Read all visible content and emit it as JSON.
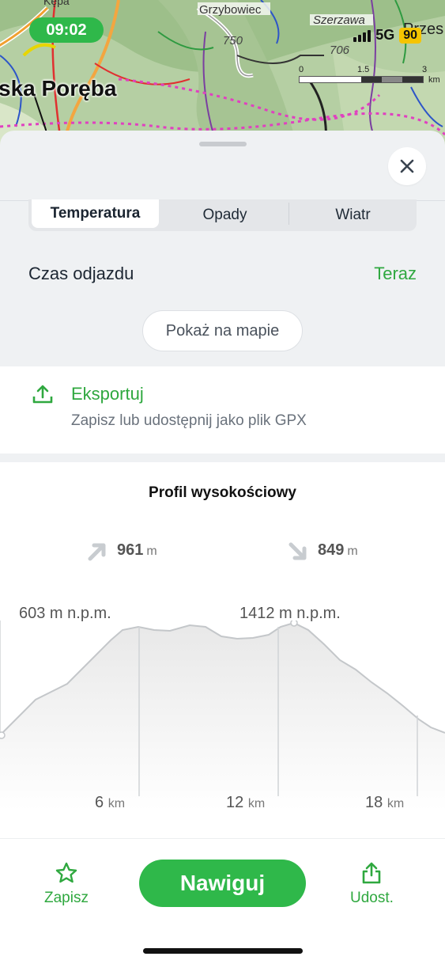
{
  "map": {
    "time": "09:02",
    "place_main": "ska Poręba",
    "place_labels": [
      "Kępa",
      "Grzybowiec",
      "Szerzawa",
      "Przes"
    ],
    "elevation_markers": [
      "750",
      "706"
    ],
    "network": "5G",
    "battery": "90",
    "scale": {
      "ticks": [
        "0",
        "1.5",
        "3"
      ],
      "unit": "km"
    }
  },
  "sheet": {
    "close_icon": "close-icon",
    "tabs": [
      {
        "label": "Temperatura",
        "active": true
      },
      {
        "label": "Opady",
        "active": false
      },
      {
        "label": "Wiatr",
        "active": false
      }
    ],
    "departure": {
      "label": "Czas odjazdu",
      "value": "Teraz"
    },
    "show_on_map": "Pokaż na mapie",
    "export": {
      "title": "Eksportuj",
      "subtitle": "Zapisz lub udostępnij jako plik GPX",
      "icon": "upload-icon"
    },
    "profile": {
      "title": "Profil wysokościowy",
      "ascent": {
        "value": "961",
        "unit": "m"
      },
      "descent": {
        "value": "849",
        "unit": "m"
      },
      "min_elevation": "603 m n.p.m.",
      "max_elevation": "1412 m n.p.m.",
      "distance_markers": [
        {
          "value": "6",
          "unit": "km"
        },
        {
          "value": "12",
          "unit": "km"
        },
        {
          "value": "18",
          "unit": "km"
        }
      ]
    }
  },
  "bottom_bar": {
    "save_label": "Zapisz",
    "navigate_label": "Nawiguj",
    "share_label": "Udost."
  },
  "colors": {
    "accent": "#2fb84a",
    "accent_text": "#2fa83f",
    "sheet_bg": "#eff1f3"
  }
}
